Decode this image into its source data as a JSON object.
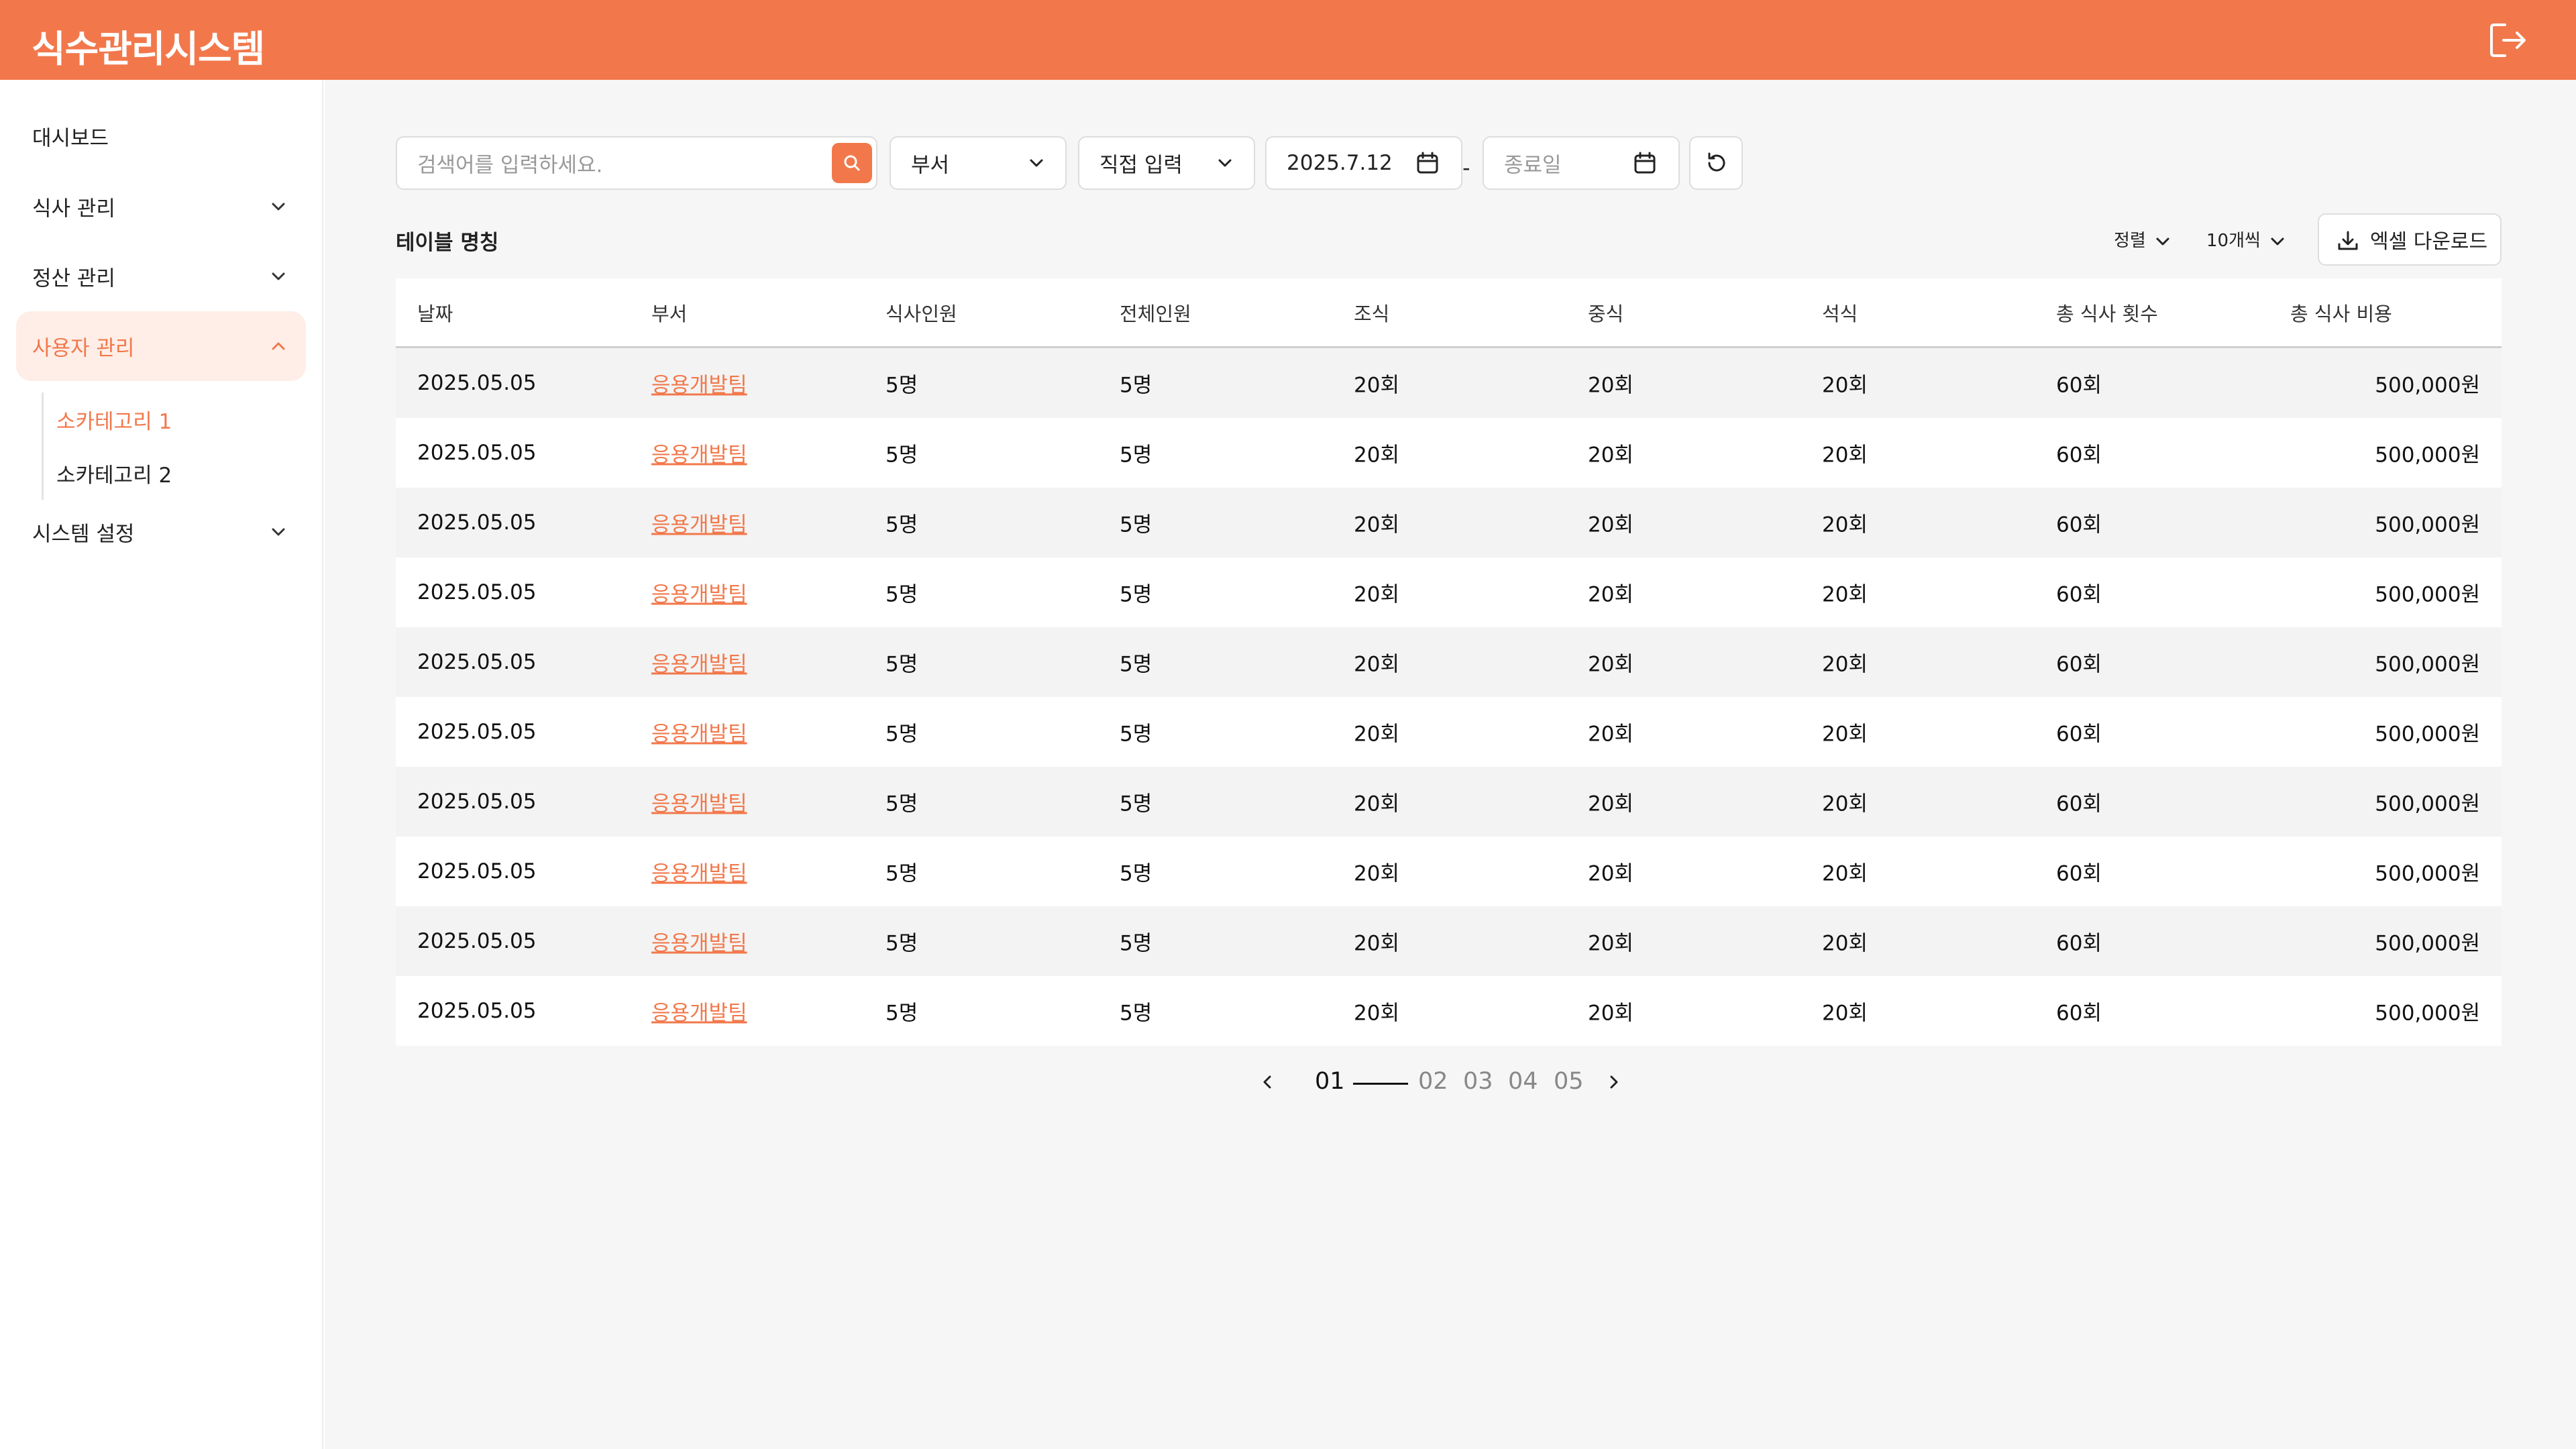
{
  "app": {
    "title": "식수관리시스템",
    "accent_color": "#F2784B",
    "logout_icon": "logout-icon"
  },
  "sidebar": {
    "items": [
      {
        "label": "대시보드"
      },
      {
        "label": "식사 관리",
        "chevron": "chevron-down"
      },
      {
        "label": "정산 관리",
        "chevron": "chevron-down"
      },
      {
        "label": "사용자 관리",
        "chevron": "chevron-up",
        "active": true,
        "children": [
          {
            "label": "소카테고리 1",
            "active": true
          },
          {
            "label": "소카테고리 2"
          }
        ]
      },
      {
        "label": "시스템 설정",
        "chevron": "chevron-down"
      }
    ]
  },
  "filters": {
    "search_placeholder": "검색어를 입력하세요.",
    "department_label": "부서",
    "period_label": "직접 입력",
    "start_date": "2025.7.12",
    "end_date_placeholder": "종료일",
    "date_separator": "-"
  },
  "table_header": {
    "title": "테이블 명칭",
    "sort_label": "정렬",
    "page_size_label": "10개씩",
    "excel_label": "엑셀 다운로드"
  },
  "table": {
    "columns": [
      "날짜",
      "부서",
      "식사인원",
      "전체인원",
      "조식",
      "중식",
      "석식",
      "총 식사 횟수",
      "총 식사 비용"
    ],
    "rows": [
      [
        "2025.05.05",
        "응용개발팀",
        "5명",
        "5명",
        "20회",
        "20회",
        "20회",
        "60회",
        "500,000원"
      ],
      [
        "2025.05.05",
        "응용개발팀",
        "5명",
        "5명",
        "20회",
        "20회",
        "20회",
        "60회",
        "500,000원"
      ],
      [
        "2025.05.05",
        "응용개발팀",
        "5명",
        "5명",
        "20회",
        "20회",
        "20회",
        "60회",
        "500,000원"
      ],
      [
        "2025.05.05",
        "응용개발팀",
        "5명",
        "5명",
        "20회",
        "20회",
        "20회",
        "60회",
        "500,000원"
      ],
      [
        "2025.05.05",
        "응용개발팀",
        "5명",
        "5명",
        "20회",
        "20회",
        "20회",
        "60회",
        "500,000원"
      ],
      [
        "2025.05.05",
        "응용개발팀",
        "5명",
        "5명",
        "20회",
        "20회",
        "20회",
        "60회",
        "500,000원"
      ],
      [
        "2025.05.05",
        "응용개발팀",
        "5명",
        "5명",
        "20회",
        "20회",
        "20회",
        "60회",
        "500,000원"
      ],
      [
        "2025.05.05",
        "응용개발팀",
        "5명",
        "5명",
        "20회",
        "20회",
        "20회",
        "60회",
        "500,000원"
      ],
      [
        "2025.05.05",
        "응용개발팀",
        "5명",
        "5명",
        "20회",
        "20회",
        "20회",
        "60회",
        "500,000원"
      ],
      [
        "2025.05.05",
        "응용개발팀",
        "5명",
        "5명",
        "20회",
        "20회",
        "20회",
        "60회",
        "500,000원"
      ]
    ]
  },
  "pagination": {
    "pages": [
      "01",
      "02",
      "03",
      "04",
      "05"
    ],
    "current": "01"
  }
}
